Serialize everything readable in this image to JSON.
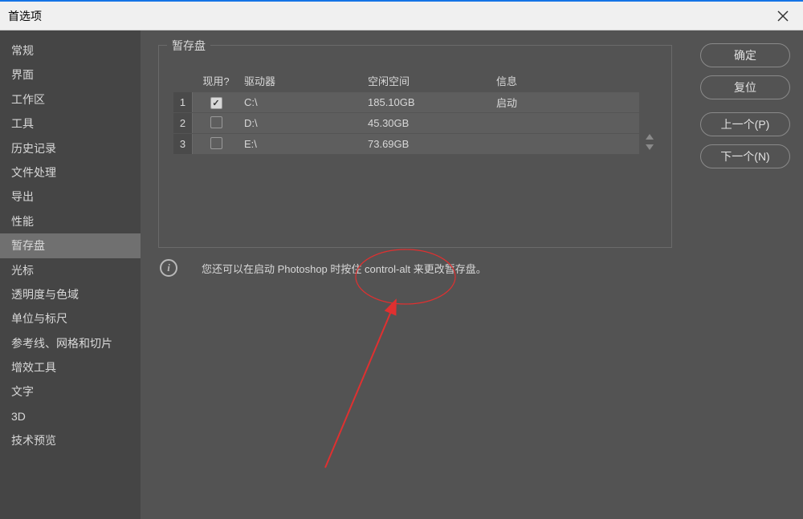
{
  "window": {
    "title": "首选项"
  },
  "sidebar": {
    "items": [
      "常规",
      "界面",
      "工作区",
      "工具",
      "历史记录",
      "文件处理",
      "导出",
      "性能",
      "暂存盘",
      "光标",
      "透明度与色域",
      "单位与标尺",
      "参考线、网格和切片",
      "增效工具",
      "文字",
      "3D",
      "技术预览"
    ],
    "active_index": 8
  },
  "panel": {
    "legend": "暂存盘",
    "headers": {
      "active": "现用?",
      "drive": "驱动器",
      "free": "空闲空间",
      "info": "信息"
    },
    "rows": [
      {
        "num": "1",
        "active": true,
        "drive": "C:\\",
        "free": "185.10GB",
        "info": "启动"
      },
      {
        "num": "2",
        "active": false,
        "drive": "D:\\",
        "free": "45.30GB",
        "info": ""
      },
      {
        "num": "3",
        "active": false,
        "drive": "E:\\",
        "free": "73.69GB",
        "info": ""
      }
    ],
    "hint": "您还可以在启动 Photoshop 时按住 control-alt 来更改暂存盘。"
  },
  "buttons": {
    "ok": "确定",
    "reset": "复位",
    "prev": "上一个(P)",
    "next": "下一个(N)"
  }
}
